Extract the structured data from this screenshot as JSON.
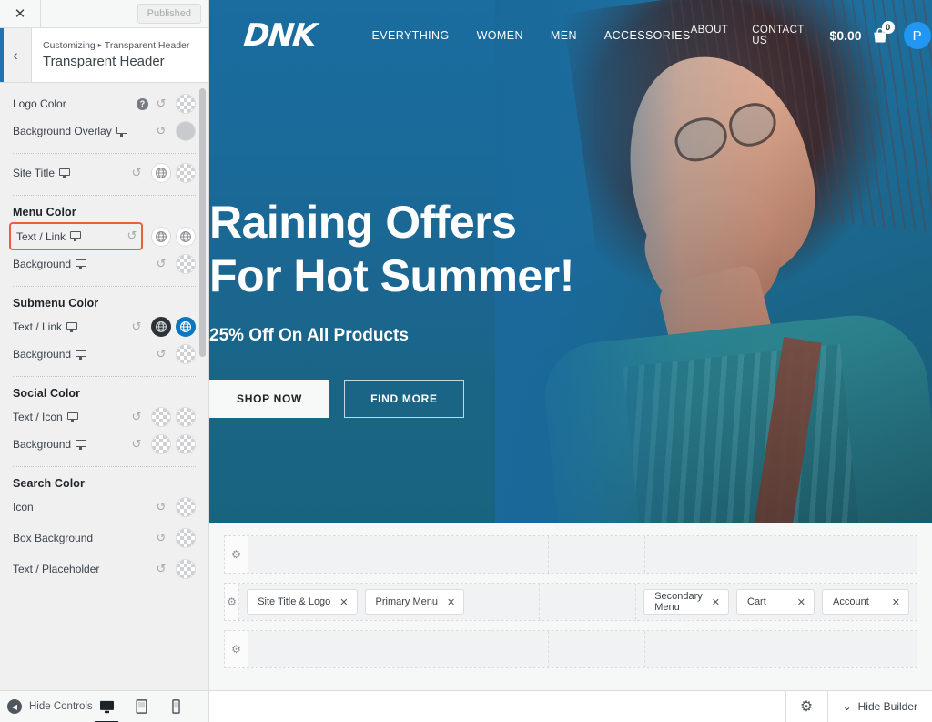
{
  "customizer": {
    "close_icon": "close-icon",
    "published_label": "Published",
    "back_icon": "chevron-left-icon",
    "breadcrumb_root": "Customizing",
    "breadcrumb_sep": "▸",
    "breadcrumb_current": "Transparent Header",
    "panel_title": "Transparent Header",
    "controls": [
      {
        "label": "Logo Color",
        "help": "?",
        "device": false,
        "reset": "↺",
        "swatches": [
          "checker"
        ]
      },
      {
        "label": "Background Overlay",
        "device": true,
        "reset": "↺",
        "swatches": [
          "solidgray"
        ]
      },
      {
        "label": "Site Title",
        "device": true,
        "reset": "↺",
        "swatches": [
          "globe-white",
          "checker"
        ]
      },
      {
        "label": "Text / Link",
        "device": true,
        "reset": "↺",
        "swatches": [
          "globe-white",
          "globe-white"
        ],
        "highlighted": true
      },
      {
        "label": "Background",
        "device": true,
        "reset": "↺",
        "swatches": [
          "checker"
        ]
      },
      {
        "label": "Text / Link",
        "device": true,
        "reset": "↺",
        "swatches": [
          "globe-dark",
          "globe-blue"
        ]
      },
      {
        "label": "Background",
        "device": true,
        "reset": "↺",
        "swatches": [
          "checker"
        ]
      },
      {
        "label": "Text / Icon",
        "device": true,
        "reset": "↺",
        "swatches": [
          "checker",
          "checker"
        ]
      },
      {
        "label": "Background",
        "device": true,
        "reset": "↺",
        "swatches": [
          "checker",
          "checker"
        ]
      },
      {
        "label": "Icon",
        "device": false,
        "reset": "↺",
        "swatches": [
          "checker"
        ]
      },
      {
        "label": "Box Background",
        "device": false,
        "reset": "↺",
        "swatches": [
          "checker"
        ]
      },
      {
        "label": "Text / Placeholder",
        "device": false,
        "reset": "↺",
        "swatches": [
          "checker"
        ]
      }
    ],
    "groups": {
      "menu_color": "Menu Color",
      "submenu_color": "Submenu Color",
      "social_color": "Social Color",
      "search_color": "Search Color"
    },
    "footer": {
      "hide_controls": "Hide Controls",
      "collapse_icon": "◀",
      "devices": [
        "desktop-icon",
        "tablet-icon",
        "mobile-icon"
      ],
      "active_device": "desktop-icon"
    }
  },
  "site": {
    "logo": "DNK",
    "primary_menu": [
      {
        "label": "EVERYTHING"
      },
      {
        "label": "WOMEN"
      },
      {
        "label": "MEN"
      },
      {
        "label": "ACCESSORIES"
      }
    ],
    "secondary_menu": [
      {
        "label": "ABOUT"
      },
      {
        "label": "CONTACT US"
      }
    ],
    "cart_price": "$0.00",
    "cart_count": "0",
    "avatar_initial": "P",
    "hero": {
      "title_line1": "Raining Offers",
      "title_line2": "For Hot Summer!",
      "subtitle": "25% Off On All Products",
      "btn_primary": "SHOP NOW",
      "btn_secondary": "FIND MORE"
    }
  },
  "header_builder": {
    "rows": [
      {
        "name": "above-header-row",
        "left": [],
        "center": [],
        "right": []
      },
      {
        "name": "primary-header-row",
        "left": [
          {
            "label": "Site Title & Logo"
          },
          {
            "label": "Primary Menu"
          }
        ],
        "center": [],
        "right": [
          {
            "label": "Secondary Menu"
          },
          {
            "label": "Cart"
          },
          {
            "label": "Account"
          }
        ]
      },
      {
        "name": "below-header-row",
        "left": [],
        "center": [],
        "right": []
      }
    ],
    "remove_icon": "✕",
    "gear_icon": "⚙",
    "bar": {
      "gear_icon": "⚙",
      "hide_builder": "Hide Builder",
      "chevron": "⌄"
    }
  },
  "colors": {
    "accent_blue": "#2271b1",
    "highlight_orange": "#e8603c",
    "hero_blue": "#1a6b9c",
    "hero_teal": "#186480",
    "swatch_blue": "#0d76bd",
    "swatch_dark": "#2c3338",
    "avatar_blue": "#2196f3"
  }
}
